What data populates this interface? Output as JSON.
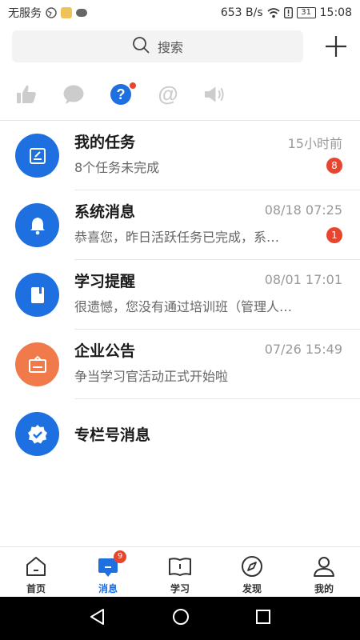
{
  "status_bar": {
    "carrier": "无服务",
    "speed": "653 B/s",
    "battery": "31",
    "time": "15:08"
  },
  "search": {
    "label": "搜索"
  },
  "filter_icons": [
    "thumbs-up-icon",
    "chat-bubble-icon",
    "question-icon",
    "at-icon",
    "speaker-icon"
  ],
  "messages": [
    {
      "title": "我的任务",
      "time": "15小时前",
      "preview": "8个任务未完成",
      "badge": "8",
      "color": "#1e6fe0",
      "icon": "task-icon"
    },
    {
      "title": "系统消息",
      "time": "08/18 07:25",
      "preview": "恭喜您，昨日活跃任务已完成，系…",
      "badge": "1",
      "color": "#1e6fe0",
      "icon": "bell-icon"
    },
    {
      "title": "学习提醒",
      "time": "08/01 17:01",
      "preview": "很遗憾，您没有通过培训班（管理人员精…",
      "badge": "",
      "color": "#1e6fe0",
      "icon": "book-icon"
    },
    {
      "title": "企业公告",
      "time": "07/26 15:49",
      "preview": "争当学习官活动正式开始啦",
      "badge": "",
      "color": "#f07a4a",
      "icon": "notice-board-icon"
    },
    {
      "title": "专栏号消息",
      "time": "",
      "preview": "",
      "badge": "",
      "color": "#1e6fe0",
      "icon": "verified-badge-icon"
    }
  ],
  "bottom_nav": [
    {
      "label": "首页",
      "icon": "home-icon",
      "active": false
    },
    {
      "label": "消息",
      "icon": "message-icon",
      "active": true,
      "badge": "9"
    },
    {
      "label": "学习",
      "icon": "book-open-icon",
      "active": false
    },
    {
      "label": "发现",
      "icon": "compass-icon",
      "active": false
    },
    {
      "label": "我的",
      "icon": "person-icon",
      "active": false
    }
  ],
  "colors": {
    "accent": "#1e6fe0",
    "badge": "#e8452f",
    "orange": "#f07a4a"
  }
}
